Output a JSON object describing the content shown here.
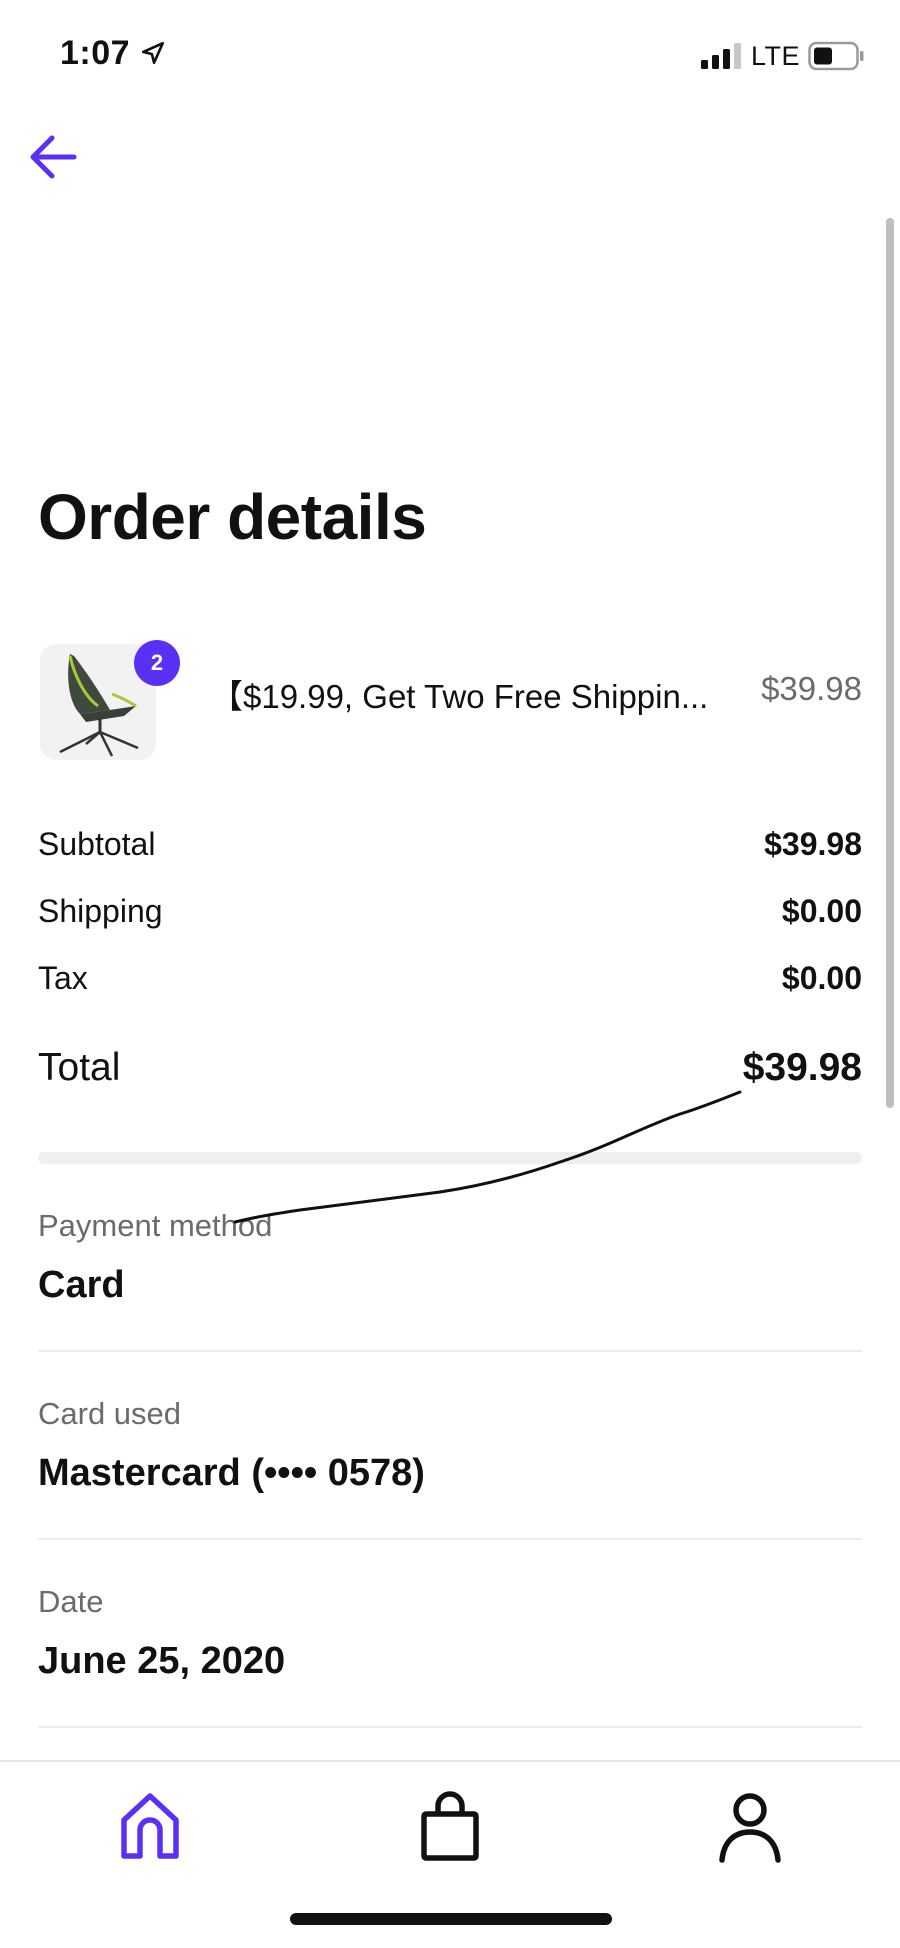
{
  "status_bar": {
    "time": "1:07",
    "network": "LTE",
    "location_icon": "location-arrow-icon",
    "signal_icon": "cellular-signal-icon",
    "battery_icon": "battery-icon"
  },
  "header": {
    "back_icon": "arrow-left-icon"
  },
  "page_title": "Order details",
  "order_item": {
    "name": "【$19.99, Get Two Free Shippin...",
    "price": "$39.98",
    "quantity": "2",
    "thumbnail_icon": "camping-chair-image"
  },
  "summary": {
    "subtotal_label": "Subtotal",
    "subtotal_value": "$39.98",
    "shipping_label": "Shipping",
    "shipping_value": "$0.00",
    "tax_label": "Tax",
    "tax_value": "$0.00",
    "total_label": "Total",
    "total_value": "$39.98"
  },
  "details": {
    "payment_method_label": "Payment method",
    "payment_method_value": "Card",
    "card_used_label": "Card used",
    "card_used_value": "Mastercard (•••• 0578)",
    "date_label": "Date",
    "date_value": "June 25, 2020"
  },
  "bottom_nav": {
    "items": [
      {
        "icon": "home-icon",
        "active": true
      },
      {
        "icon": "shopping-bag-icon",
        "active": false
      },
      {
        "icon": "user-icon",
        "active": false
      }
    ]
  },
  "colors": {
    "accent": "#5a31f4",
    "text": "#111111",
    "muted": "#6b6b6b"
  }
}
